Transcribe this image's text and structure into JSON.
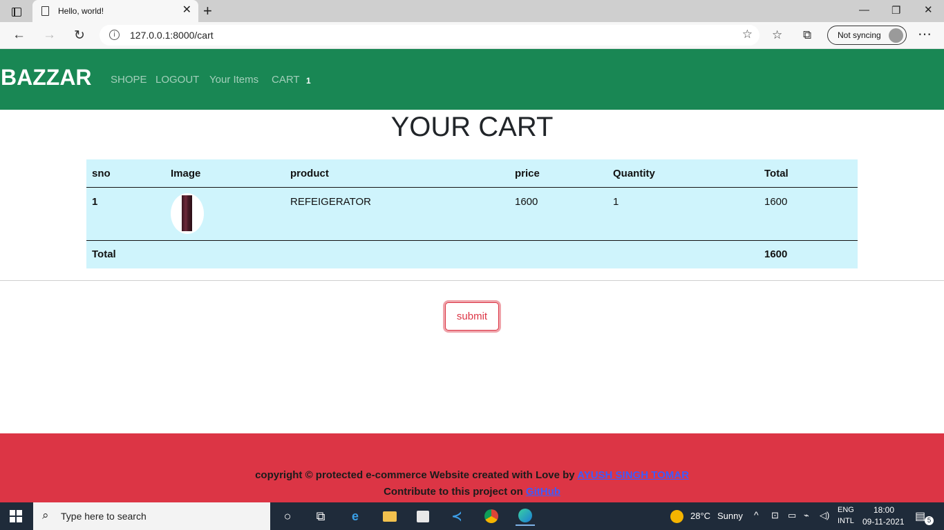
{
  "browser": {
    "tab_title": "Hello, world!",
    "tab_close": "✕",
    "new_tab": "+",
    "url": "127.0.0.1:8000/cart",
    "sync_label": "Not syncing"
  },
  "navbar": {
    "brand": "BAZZAR",
    "links": [
      "SHOPE",
      "LOGOUT",
      "Your Items",
      "CART"
    ],
    "cart_count": "1"
  },
  "page": {
    "heading": "YOUR CART"
  },
  "table": {
    "headers": [
      "sno",
      "Image",
      "product",
      "price",
      "Quantity",
      "Total"
    ],
    "rows": [
      {
        "sno": "1",
        "product": "REFEIGERATOR",
        "price": "1600",
        "quantity": "1",
        "total": "1600"
      }
    ],
    "total_label": "Total",
    "total_value": "1600"
  },
  "submit_label": "submit",
  "footer": {
    "line1_text": "copyright © protected e-commerce Website created with Love by ",
    "line1_link": "AYUSH SINGH TOMAR",
    "line2_text": "Contribute to this project on ",
    "line2_link": "GitHub"
  },
  "taskbar": {
    "search_placeholder": "Type here to search",
    "weather_temp": "28°C",
    "weather_desc": "Sunny",
    "lang_1": "ENG",
    "lang_2": "INTL",
    "time": "18:00",
    "date": "09-11-2021",
    "notifications": "5"
  },
  "colors": {
    "navbar": "#198754",
    "table_bg": "#cff4fc",
    "footer": "#dc3545",
    "submit": "#dc3545",
    "link": "#3b5bff"
  }
}
